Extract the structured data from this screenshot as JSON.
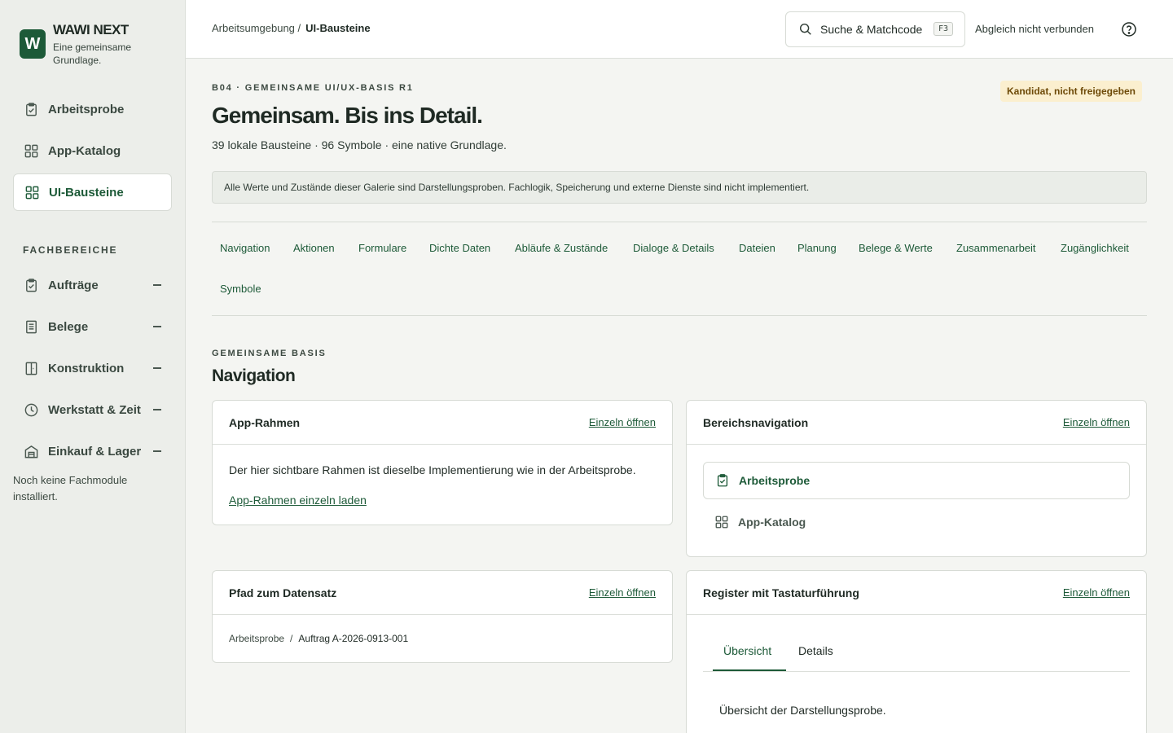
{
  "brand": {
    "logo_letter": "W",
    "name": "WAWI NEXT",
    "tagline": "Eine gemeinsame Grundlage."
  },
  "sidebar": {
    "main_items": [
      {
        "label": "Arbeitsprobe",
        "icon": "clipboard-check-icon"
      },
      {
        "label": "App-Katalog",
        "icon": "grid-icon"
      },
      {
        "label": "UI-Bausteine",
        "icon": "grid-icon",
        "active": true
      }
    ],
    "section_label": "FACHBEREICHE",
    "domain_items": [
      {
        "label": "Aufträge",
        "icon": "clipboard-check-icon"
      },
      {
        "label": "Belege",
        "icon": "receipt-icon"
      },
      {
        "label": "Konstruktion",
        "icon": "door-icon"
      },
      {
        "label": "Werkstatt & Zeit",
        "icon": "clock-icon"
      },
      {
        "label": "Einkauf & Lager",
        "icon": "warehouse-icon"
      }
    ],
    "note": "Noch keine Fachmodule installiert."
  },
  "topbar": {
    "breadcrumb_parent": "Arbeitsumgebung /",
    "breadcrumb_current": "UI-Bausteine",
    "search_label": "Suche & Matchcode",
    "search_shortcut": "F3",
    "sync_status": "Abgleich nicht verbunden",
    "help_icon": "help-circle-icon"
  },
  "header": {
    "eyebrow": "B04 · GEMEINSAME UI/UX-BASIS R1",
    "badge": "Kandidat, nicht freigegeben",
    "title": "Gemeinsam. Bis ins Detail.",
    "subtitle": "39 lokale Bausteine · 96 Symbole · eine native Grundlage.",
    "notice": "Alle Werte und Zustände dieser Galerie sind Darstellungsproben. Fachlogik, Speicherung und externe Dienste sind nicht implementiert."
  },
  "categories": [
    "Navigation",
    "Aktionen",
    "Formulare",
    "Dichte Daten",
    "Abläufe & Zustände",
    "Dialoge & Details",
    "Dateien",
    "Planung",
    "Belege & Werte",
    "Zusammenarbeit",
    "Zugänglichkeit",
    "Symbole"
  ],
  "section": {
    "eyebrow": "GEMEINSAME BASIS",
    "title": "Navigation"
  },
  "cards": {
    "open_label": "Einzeln öffnen",
    "app_frame": {
      "title": "App-Rahmen",
      "text": "Der hier sichtbare Rahmen ist dieselbe Implementierung wie in der Arbeitsprobe.",
      "link": "App-Rahmen einzeln laden"
    },
    "area_nav": {
      "title": "Bereichsnavigation",
      "items": [
        "Arbeitsprobe",
        "App-Katalog"
      ]
    },
    "record_path": {
      "title": "Pfad zum Datensatz",
      "parent": "Arbeitsprobe",
      "separator": "/",
      "current": "Auftrag A-2026-0913-001"
    },
    "register": {
      "title": "Register mit Tastaturführung",
      "tabs": [
        "Übersicht",
        "Details"
      ],
      "content": "Übersicht der Darstellungsprobe."
    }
  },
  "colors": {
    "accent": "#1d5a38",
    "badge_bg": "#fbefcf",
    "badge_fg": "#6e4a08"
  }
}
